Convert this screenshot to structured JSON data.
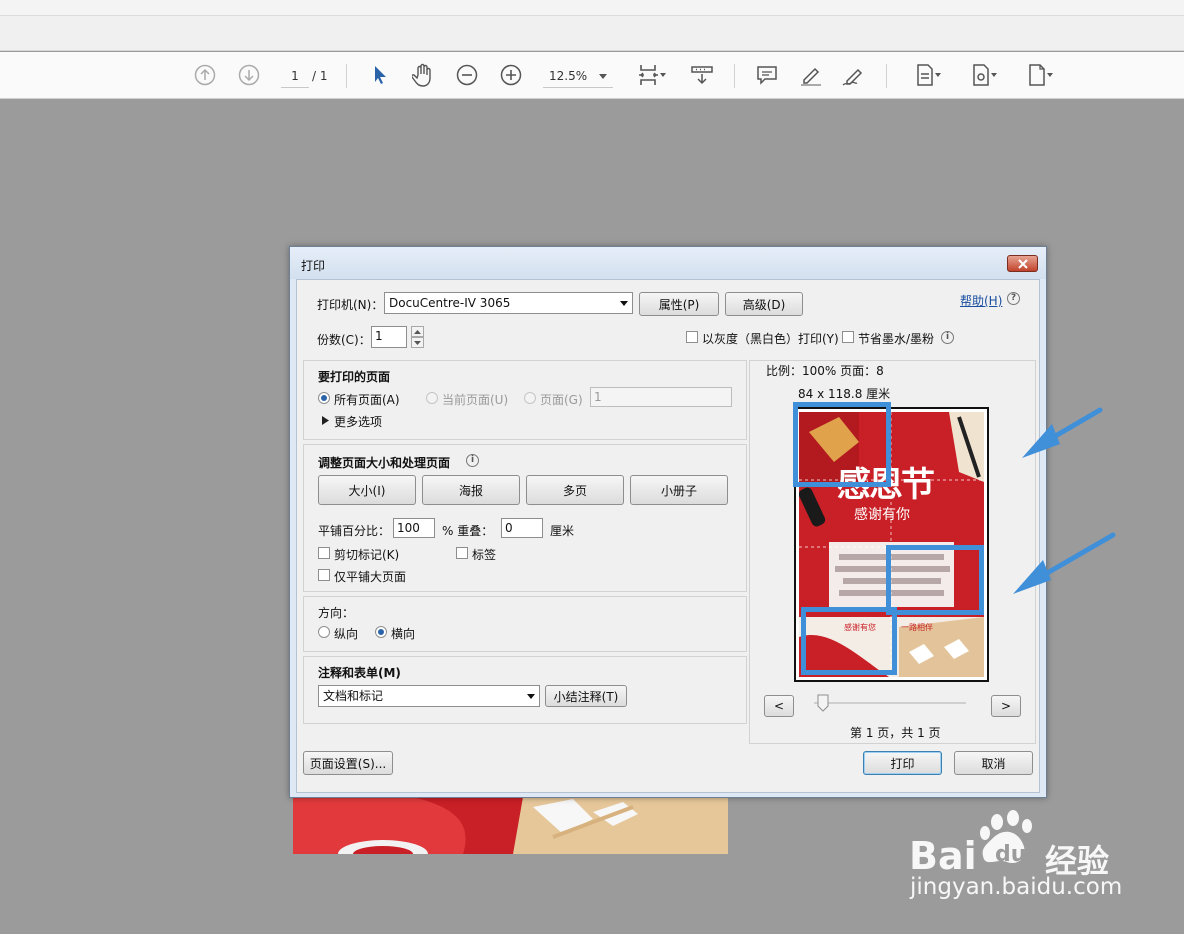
{
  "toolbar": {
    "page_current": "1",
    "page_total": "/ 1",
    "zoom": "12.5%"
  },
  "dialog": {
    "title": "打印",
    "printer_label": "打印机(N)：",
    "printer_value": "DocuCentre-IV 3065",
    "properties_button": "属性(P)",
    "advanced_button": "高级(D)",
    "help_link": "帮助(H)",
    "copies_label": "份数(C)：",
    "copies_value": "1",
    "grayscale_label": "以灰度（黑白色）打印(Y)",
    "save_ink_label": "节省墨水/墨粉",
    "pages_section_title": "要打印的页面",
    "pages_all": "所有页面(A)",
    "pages_current": "当前页面(U)",
    "pages_range": "页面(G)",
    "pages_range_value": "1",
    "more_options": "更多选项",
    "sizing_section_title": "调整页面大小和处理页面",
    "size_button": "大小(I)",
    "poster_button": "海报",
    "multiple_button": "多页",
    "booklet_button": "小册子",
    "tile_scale_label": "平铺百分比：",
    "tile_scale_value": "100",
    "overlap_label": "% 重叠：",
    "overlap_value": "0",
    "overlap_unit": "厘米",
    "cut_marks_label": "剪切标记(K)",
    "labels_label": "标签",
    "tile_large_only_label": "仅平铺大页面",
    "orientation_title": "方向：",
    "orientation_portrait": "纵向",
    "orientation_landscape": "横向",
    "comments_title": "注释和表单(M)",
    "comments_value": "文档和标记",
    "summarize_button": "小结注释(T)",
    "scale_info": "比例：100% 页面：8",
    "paper_size": "84 x 118.8 厘米",
    "prev_button": "<",
    "next_button": ">",
    "page_counter": "第 1 页，共 1 页",
    "page_setup_button": "页面设置(S)...",
    "print_button": "打印",
    "cancel_button": "取消"
  },
  "preview": {
    "poster_title": "感恩节",
    "poster_subtitle": "感谢有你",
    "poster_line1": "感谢有您",
    "poster_line2": "一路相伴"
  },
  "watermark": {
    "brand": "Bai",
    "brand2": "du",
    "brand_cn": "经验",
    "url": "jingyan.baidu.com"
  },
  "colors": {
    "highlight": "#3f8fd9",
    "poster_red": "#c91f26",
    "background_gray": "#9b9b9b"
  }
}
